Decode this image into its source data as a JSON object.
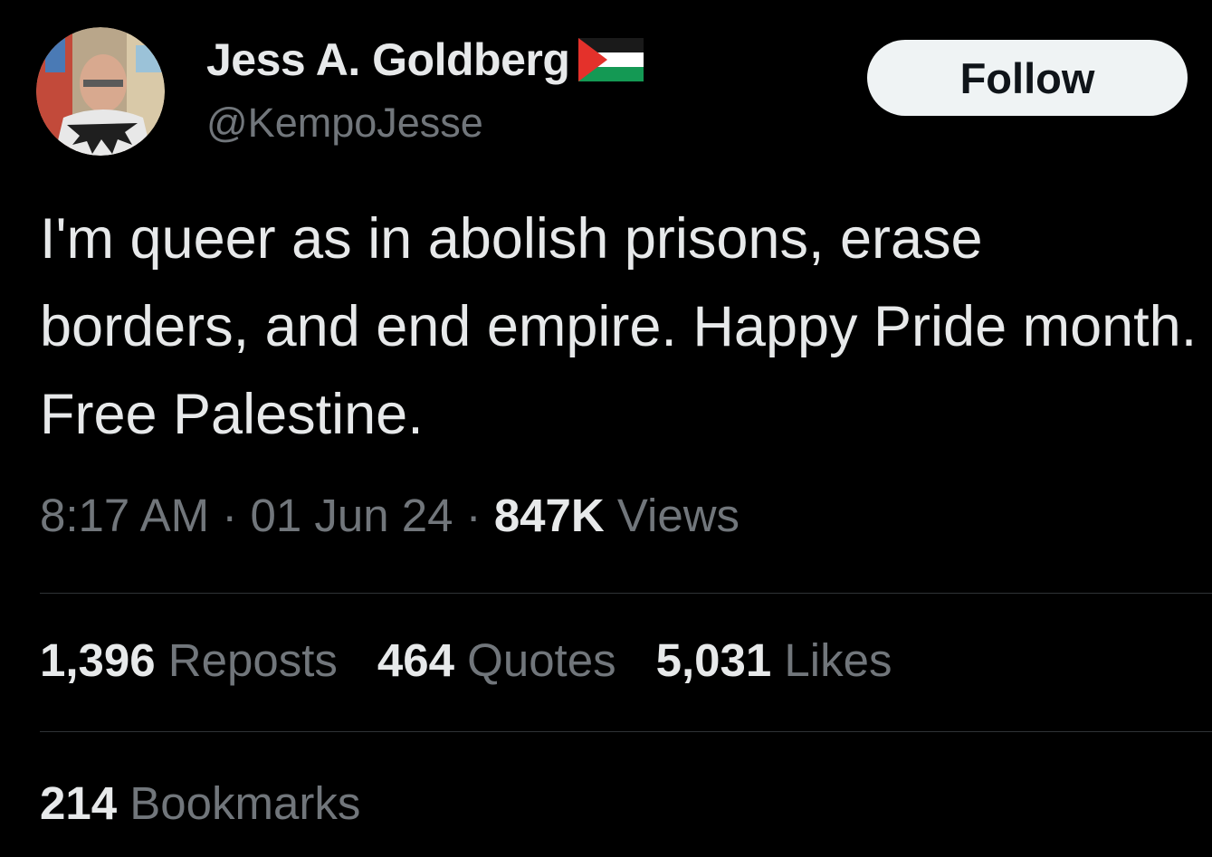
{
  "author": {
    "display_name": "Jess A. Goldberg",
    "handle": "@KempoJesse",
    "flag_icon": "palestine-flag-emoji"
  },
  "follow_label": "Follow",
  "tweet": {
    "text": "I'm queer as in abolish prisons, erase borders, and end empire. Happy Pride month. Free Palestine."
  },
  "meta": {
    "time": "8:17 AM",
    "separator": "·",
    "date": "01 Jun 24",
    "views_count": "847K",
    "views_label": "Views"
  },
  "stats": {
    "reposts_count": "1,396",
    "reposts_label": "Reposts",
    "quotes_count": "464",
    "quotes_label": "Quotes",
    "likes_count": "5,031",
    "likes_label": "Likes",
    "bookmarks_count": "214",
    "bookmarks_label": "Bookmarks"
  },
  "colors": {
    "background": "#000000",
    "primary_text": "#e7e9ea",
    "secondary_text": "#71767b",
    "follow_bg": "#eff3f4",
    "divider": "#2f3336"
  }
}
